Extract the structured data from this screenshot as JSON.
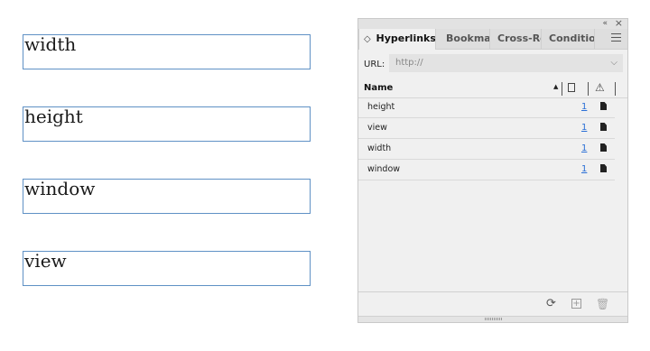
{
  "document": {
    "frames": [
      "width",
      "height",
      "window",
      "view"
    ]
  },
  "panel": {
    "topbar": {
      "collapse_icon": "«",
      "close_icon": "×"
    },
    "tabs": [
      {
        "label": "Hyperlinks",
        "icon": "◇",
        "active": true
      },
      {
        "label": "Bookmarks",
        "active": false
      },
      {
        "label": "Cross-References",
        "active": false
      },
      {
        "label": "Conditional Text",
        "active": false
      }
    ],
    "url_label": "URL:",
    "url_value": "http://",
    "url_chevron": "⌵",
    "list_header": {
      "name": "Name",
      "sort_indicator": "▲",
      "warning_icon": "⚠"
    },
    "rows": [
      {
        "name": "height",
        "page": "1"
      },
      {
        "name": "view",
        "page": "1"
      },
      {
        "name": "width",
        "page": "1"
      },
      {
        "name": "window",
        "page": "1"
      }
    ],
    "footer": {
      "refresh_icon": "⟳",
      "new_icon": "+",
      "trash_icon": "🗑"
    }
  }
}
